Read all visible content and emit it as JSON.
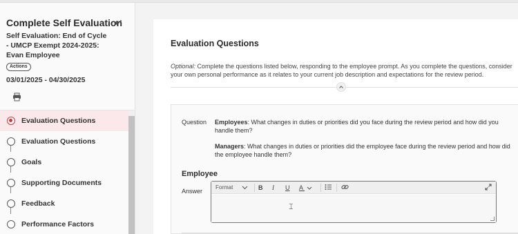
{
  "sidebar": {
    "title": "Complete Self Evaluation",
    "subtitle": "Self Evaluation: End of Cycle - UMCP Exempt 2024-2025: Evan Employee",
    "actions_label": "Actions",
    "dates": "03/01/2025 - 04/30/2025",
    "steps": [
      {
        "label": "Evaluation Questions",
        "active": true
      },
      {
        "label": "Evaluation Questions",
        "active": false
      },
      {
        "label": "Goals",
        "active": false
      },
      {
        "label": "Supporting Documents",
        "active": false
      },
      {
        "label": "Feedback",
        "active": false
      },
      {
        "label": "Performance Factors",
        "active": false
      }
    ],
    "accent_color": "#d3353f"
  },
  "main": {
    "heading": "Evaluation Questions",
    "intro_optional": "Optional:",
    "intro_text": " Complete the questions listed below, responding to the employee prompt. As you complete the questions, consider your own personal performance as it relates to your current job description and expectations for the review period.",
    "question": {
      "label": "Question",
      "employees_prefix": "Employees",
      "employees_text": ": What changes in duties or priorities did you face during the review period and how did you handle them?",
      "managers_prefix": "Managers",
      "managers_text": ": What changes in duties or priorities did the employee face during the review period and how did the employee handle them?"
    },
    "employee_heading": "Employee",
    "answer_label": "Answer",
    "editor": {
      "format_label": "Format",
      "bold": "B",
      "italic": "I",
      "underline": "U",
      "text_color": "A",
      "value": ""
    }
  }
}
